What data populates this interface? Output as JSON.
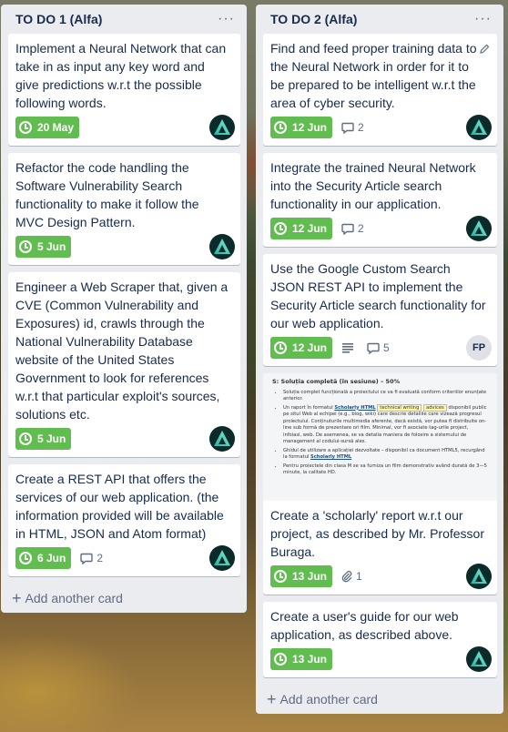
{
  "lists": [
    {
      "title": "TO DO 1 (Alfa)",
      "menu": "···",
      "add_card": "Add another card",
      "cards": [
        {
          "title": "Implement a Neural Network that can take in as input any key word and give predictions w.r.t the possible following words.",
          "due": "20 May"
        },
        {
          "title": "Refactor the code handling the Software Vulnerability Search functionality to make it follow the MVC Design Pattern.",
          "due": "5 Jun"
        },
        {
          "title": "Engineer a Web Scraper that, given a CVE (Common Vulnerability and Exposures) id, crawls through the National Vulnerability Database website of the United States Government to look for references w.r.t that particular exploit's sources, solutions etc.",
          "due": "5 Jun"
        },
        {
          "title": "Create a REST API that offers the services of our web application. (the information provided will be available in HTML, JSON and Atom format)",
          "due": "6 Jun",
          "comments": "2"
        }
      ]
    },
    {
      "title": "TO DO 2 (Alfa)",
      "menu": "···",
      "add_card": "Add another card",
      "cards": [
        {
          "title": "Find and feed proper training data to the Neural Network in order for it to be prepared to be intelligent w.r.t the area of cyber security.",
          "due": "12 Jun",
          "comments": "2"
        },
        {
          "title": "Integrate the trained Neural Network into the Security Article search functionality in our application.",
          "due": "12 Jun",
          "comments": "2"
        },
        {
          "title": "Use the Google Custom Search JSON REST API to implement the Security Article search functionality for our web application.",
          "due": "12 Jun",
          "comments": "5",
          "member_initials": "FP"
        },
        {
          "title": "Create a 'scholarly' report w.r.t our project, as described by Mr. Professor Buraga.",
          "due": "13 Jun",
          "attachments": "1",
          "cover": {
            "heading": "S: Soluția completă (în sesiune) – 50%",
            "b1": "Soluția complet funcțională a proiectului ce va fi evaluată conform criteriilor enunțate anterior.",
            "b2a": "Un raport în formatul",
            "b2link": "Scholarly HTML",
            "b2tag1": "technical writing",
            "b2tag2": "advices",
            "b2b": "disponibil public pe situl Web al echipei (e.g., blog, wiki) care descrie detaliile care vizează progresul proiectului. Conținuturile multimedia aferente, dacă există, vor putea fi distribuite on-line sub formă de prezentare ori film. Minimal, vor fi asociate tag-urile project, infoiasi, web. De asemenea, se va detalia maniera de folosire a sistemului de management al codului-sursă ales.",
            "b3a": "Ghidul de utilizare a aplicației dezvoltate – disponibil ca document HTML5, recurgând la formatul",
            "b3link": "Scholarly HTML",
            "b4": "Pentru proiectele din clasa M se va furniza un film demonstrativ având durată de 3—5 minute, la calitate HD."
          }
        },
        {
          "title": "Create a user's guide for our web application, as described above.",
          "due": "13 Jun"
        }
      ]
    }
  ]
}
